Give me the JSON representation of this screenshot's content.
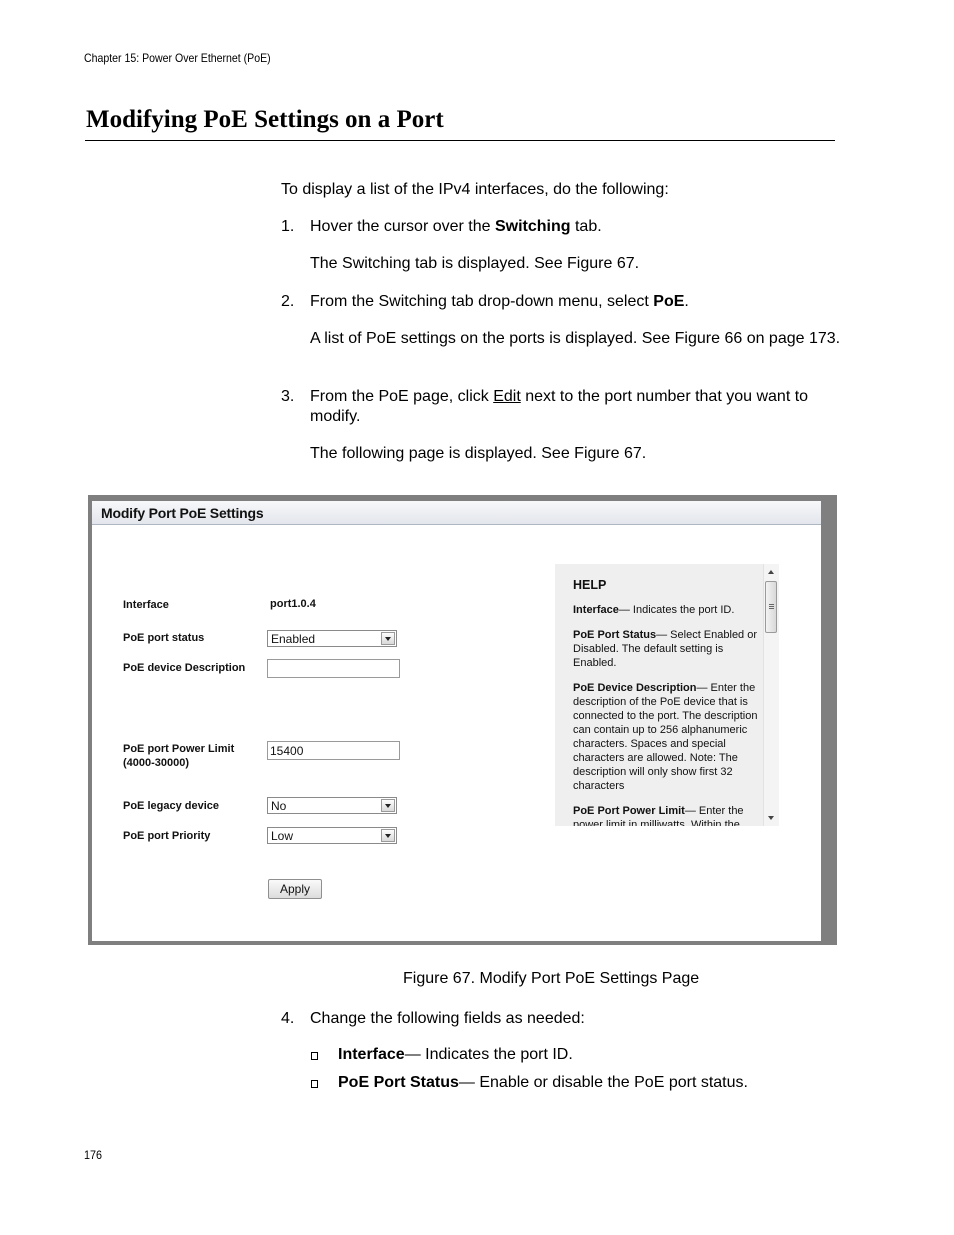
{
  "header": {
    "chapter": "Chapter 15: Power Over Ethernet (PoE)"
  },
  "section": {
    "title": "Modifying PoE Settings on a Port"
  },
  "intro": "To display a list of the IPv4 interfaces, do the following:",
  "steps": [
    {
      "num": "1.",
      "pre": "Hover the cursor over the ",
      "bold": "Switching",
      "post": " tab.",
      "note": "The Switching tab is displayed. See Figure 67."
    },
    {
      "num": "2.",
      "pre": "From the Switching tab drop-down menu, select ",
      "bold": "PoE",
      "post": ".",
      "note": "A list of PoE settings on the ports is displayed. See Figure 66 on page 173."
    },
    {
      "num": "3.",
      "pre": "From the PoE page, click ",
      "link": "Edit",
      "post": " next to the port number that you want to modify.",
      "note": "The following page is displayed. See Figure 67."
    },
    {
      "num": "4.",
      "text": "Change the following fields as needed:"
    }
  ],
  "figure": {
    "title": "Modify Port PoE Settings",
    "fields": {
      "interface_label": "Interface",
      "interface_value": "port1.0.4",
      "status_label": "PoE port status",
      "status_value": "Enabled",
      "description_label": "PoE device Description",
      "description_value": "",
      "power_label": "PoE port Power Limit",
      "power_range": "(4000-30000)",
      "power_value": "15400",
      "legacy_label": "PoE legacy device",
      "legacy_value": "No",
      "priority_label": "PoE port Priority",
      "priority_value": "Low"
    },
    "apply_label": "Apply",
    "help": {
      "heading": "HELP",
      "items": [
        {
          "term": "Interface",
          "desc": "— Indicates the port ID."
        },
        {
          "term": "PoE Port Status",
          "desc": "— Select Enabled or Disabled. The default setting is Enabled."
        },
        {
          "term": "PoE Device Description",
          "desc": "— Enter the description of the PoE device that is connected to the port. The description can contain up to 256 alphanumeric characters. Spaces and special characters are allowed. Note: The description will only show first 32 characters"
        },
        {
          "term": "PoE Port Power Limit",
          "desc": "— Enter the power limit in milliwatts. Within the range."
        }
      ]
    },
    "caption": "Figure 67. Modify Port PoE Settings Page"
  },
  "bullets": [
    {
      "term": "Interface",
      "desc": "— Indicates the port ID."
    },
    {
      "term": "PoE Port Status",
      "desc": "— Enable or disable the PoE port status."
    }
  ],
  "footer": {
    "page_number": "176"
  }
}
